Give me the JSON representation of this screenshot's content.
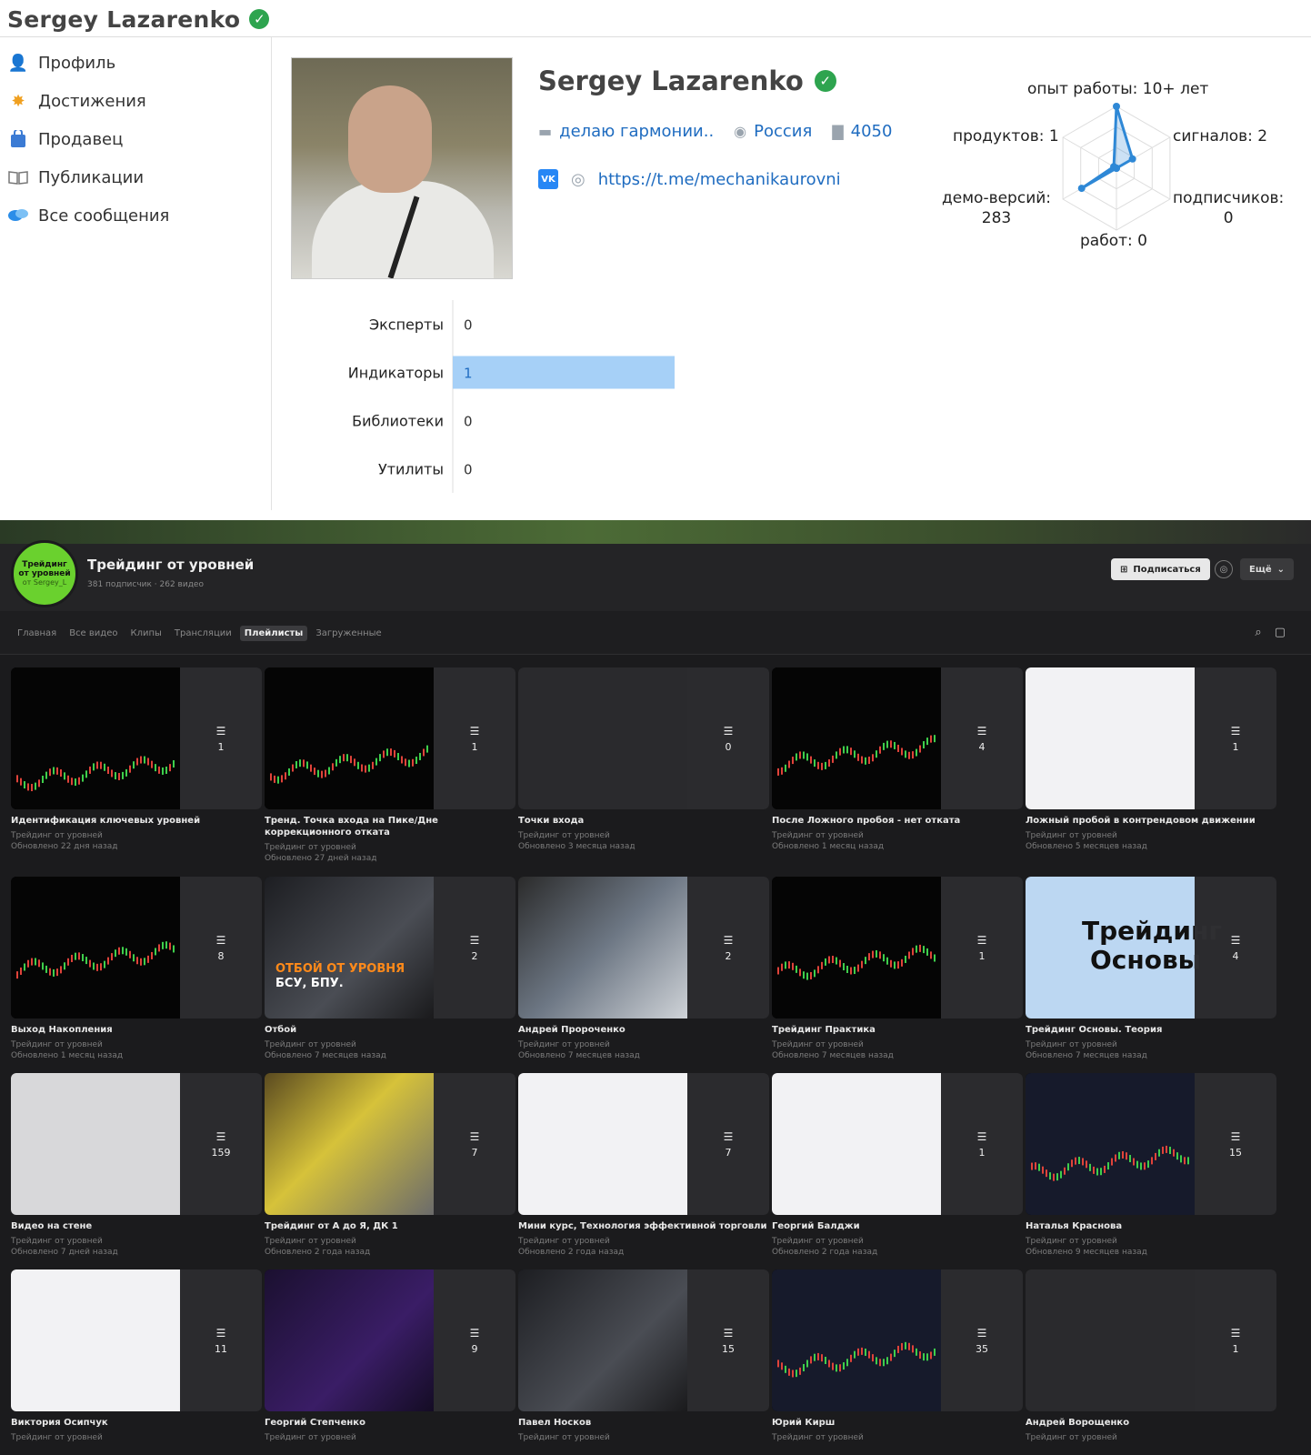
{
  "profile": {
    "name": "Sergey Lazarenko",
    "status": "делаю гармонии..",
    "country": "Россия",
    "rating": "4050",
    "link": "https://t.me/mechanikaurovni",
    "vk_label": "VK"
  },
  "sidebar": {
    "items": [
      {
        "label": "Профиль",
        "icon": "user-icon"
      },
      {
        "label": "Достижения",
        "icon": "award-icon"
      },
      {
        "label": "Продавец",
        "icon": "seller-bag-icon"
      },
      {
        "label": "Публикации",
        "icon": "book-icon"
      },
      {
        "label": "Все сообщения",
        "icon": "messages-icon"
      }
    ]
  },
  "radar": {
    "labels": {
      "experience": "опыт работы: 10+ лет",
      "products": "продуктов: 1",
      "signals": "сигналов: 2",
      "demos_a": "демо-версий:",
      "demos_b": "283",
      "subscribers_a": "подписчиков:",
      "subscribers_b": "0",
      "jobs": "работ: 0"
    },
    "values": {
      "experience": 1.0,
      "signals": 0.3,
      "subscribers": 0.0,
      "jobs": 0.0,
      "demos": 0.65,
      "products": 0.05
    }
  },
  "chart_data": {
    "type": "bar",
    "orientation": "horizontal",
    "categories": [
      "Эксперты",
      "Индикаторы",
      "Библиотеки",
      "Утилиты"
    ],
    "values": [
      0,
      1,
      0,
      0
    ],
    "xlim": [
      0,
      1
    ],
    "bar_color": "#a6d0f7"
  },
  "channel": {
    "logo_line1": "Трейдинг",
    "logo_line2": "от уровней",
    "logo_line3": "от Sergey_L",
    "title": "Трейдинг от уровней",
    "subtitle": "381 подписчик · 262 видео",
    "subscribe_label": "Подписаться",
    "more_label": "Ещё",
    "tabs": [
      "Главная",
      "Все видео",
      "Клипы",
      "Трансляции",
      "Плейлисты",
      "Загруженные"
    ],
    "active_tab": "Плейлисты"
  },
  "playlists": [
    {
      "title": "Идентификация ключевых уровней",
      "author": "Трейдинг от уровней",
      "updated": "Обновлено 22 дня назад",
      "count": "1",
      "style": "chart"
    },
    {
      "title": "Тренд. Точка входа на Пике/Дне коррекционного отката",
      "author": "Трейдинг от уровней",
      "updated": "Обновлено 27 дней назад",
      "count": "1",
      "style": "chart"
    },
    {
      "title": "Точки входа",
      "author": "Трейдинг от уровней",
      "updated": "Обновлено 3 месяца назад",
      "count": "0",
      "style": "dark"
    },
    {
      "title": "После Ложного пробоя - нет отката",
      "author": "Трейдинг от уровней",
      "updated": "Обновлено 1 месяц назад",
      "count": "4",
      "style": "chart"
    },
    {
      "title": "Ложный пробой в контрендовом движении",
      "author": "Трейдинг от уровней",
      "updated": "Обновлено 5 месяцев назад",
      "count": "1",
      "style": "white"
    },
    {
      "title": "Выход Накопления",
      "author": "Трейдинг от уровней",
      "updated": "Обновлено 1 месяц назад",
      "count": "8",
      "style": "chart"
    },
    {
      "title": "Отбой",
      "author": "Трейдинг от уровней",
      "updated": "Обновлено 7 месяцев назад",
      "count": "2",
      "style": "person"
    },
    {
      "title": "Андрей Пророченко",
      "author": "Трейдинг от уровней",
      "updated": "Обновлено 7 месяцев назад",
      "count": "2",
      "style": "room"
    },
    {
      "title": "Трейдинг Практика",
      "author": "Трейдинг от уровней",
      "updated": "Обновлено 7 месяцев назад",
      "count": "1",
      "style": "chart"
    },
    {
      "title": "Трейдинг Основы. Теория",
      "author": "Трейдинг от уровней",
      "updated": "Обновлено 7 месяцев назад",
      "count": "4",
      "style": "blue"
    },
    {
      "title": "Видео на стене",
      "author": "Трейдинг от уровней",
      "updated": "Обновлено 7 дней назад",
      "count": "159",
      "style": "gray"
    },
    {
      "title": "Трейдинг от А до Я, ДК 1",
      "author": "Трейдинг от уровней",
      "updated": "Обновлено 2 года назад",
      "count": "7",
      "style": "yellow"
    },
    {
      "title": "Мини курс, Технология эффективной торговли",
      "author": "Трейдинг от уровней",
      "updated": "Обновлено 2 года назад",
      "count": "7",
      "style": "white"
    },
    {
      "title": "Георгий Балджи",
      "author": "Трейдинг от уровней",
      "updated": "Обновлено 2 года назад",
      "count": "1",
      "style": "white"
    },
    {
      "title": "Наталья Краснова",
      "author": "Трейдинг от уровней",
      "updated": "Обновлено 9 месяцев назад",
      "count": "15",
      "style": "navy"
    },
    {
      "title": "Виктория Осипчук",
      "author": "Трейдинг от уровней",
      "updated": "",
      "count": "11",
      "style": "white"
    },
    {
      "title": "Георгий Степченко",
      "author": "Трейдинг от уровней",
      "updated": "",
      "count": "9",
      "style": "purple"
    },
    {
      "title": "Павел Носков",
      "author": "Трейдинг от уровней",
      "updated": "",
      "count": "15",
      "style": "person"
    },
    {
      "title": "Юрий Кирш",
      "author": "Трейдинг от уровней",
      "updated": "",
      "count": "35",
      "style": "navy"
    },
    {
      "title": "Андрей Ворощенко",
      "author": "Трейдинг от уровней",
      "updated": "",
      "count": "1",
      "style": "dark"
    }
  ],
  "thumb_texts": {
    "basics_line1": "Трейдинг",
    "basics_line2": "Основы",
    "rebound_line1": "ОТБОЙ ОТ УРОВНЯ",
    "rebound_line2": "БСУ, БПУ."
  }
}
